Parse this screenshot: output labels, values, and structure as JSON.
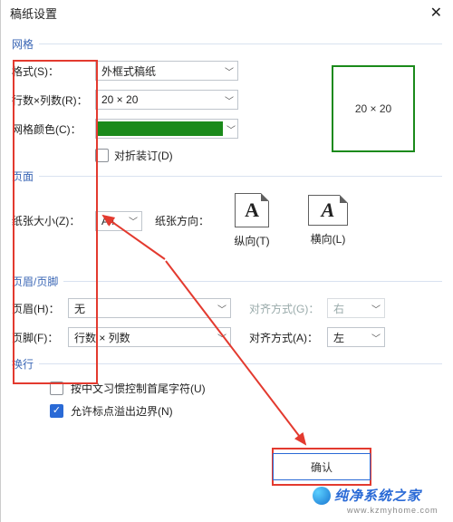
{
  "title": "稿纸设置",
  "groups": {
    "grid_label": "网格",
    "page_label": "页面",
    "headerfooter_label": "页眉/页脚",
    "wrap_label": "换行"
  },
  "grid": {
    "format_label": "格式(S)：",
    "format_value": "外框式稿纸",
    "rowscols_label": "行数×列数(R)：",
    "rowscols_value": "20 × 20",
    "color_label": "网格颜色(C)：",
    "color_value": "#1b8a1b",
    "fold_label": "对折装订(D)",
    "preview_text": "20 × 20"
  },
  "page": {
    "size_label": "纸张大小(Z)：",
    "size_value": "A4",
    "orient_label": "纸张方向：",
    "portrait_label": "纵向(T)",
    "landscape_label": "横向(L)"
  },
  "hf": {
    "header_label": "页眉(H)：",
    "header_value": "无",
    "header_align_label": "对齐方式(G)：",
    "header_align_value": "右",
    "footer_label": "页脚(F)：",
    "footer_value": "行数 × 列数",
    "footer_align_label": "对齐方式(A)：",
    "footer_align_value": "左"
  },
  "wrap": {
    "cjk_label": "按中文习惯控制首尾字符(U)",
    "overflow_label": "允许标点溢出边界(N)"
  },
  "buttons": {
    "ok": "确认"
  },
  "watermark": {
    "brand": "纯净系统之家",
    "url": "www.kzmyhome.com"
  }
}
